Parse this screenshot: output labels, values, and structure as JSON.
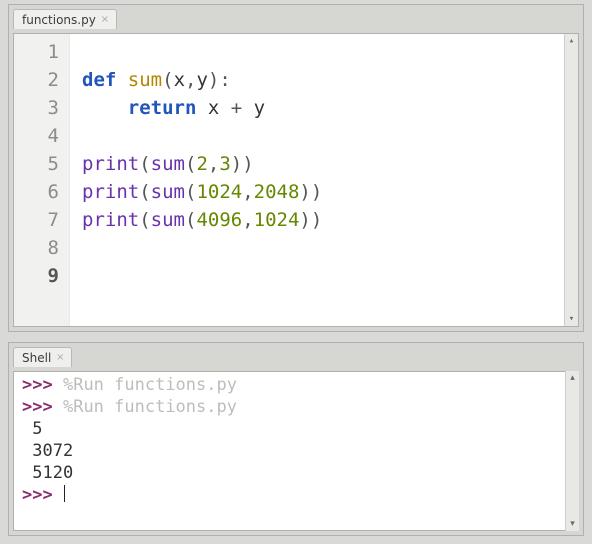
{
  "editor": {
    "tab_label": "functions.py",
    "gutter": [
      "1",
      "2",
      "3",
      "4",
      "5",
      "6",
      "7",
      "8",
      "9"
    ],
    "current_line_index": 8,
    "code": {
      "line1": "",
      "line2": {
        "kw_def": "def",
        "sp1": " ",
        "name": "sum",
        "args_open": "(",
        "arg1": "x",
        "comma1": ",",
        "arg2": "y",
        "args_close": ")",
        "colon": ":"
      },
      "line3": {
        "indent": "    ",
        "kw_return": "return",
        "sp1": " ",
        "x": "x",
        "sp2": " ",
        "plus": "+",
        "sp3": " ",
        "y": "y"
      },
      "line4": "",
      "line5": {
        "print": "print",
        "lp": "(",
        "sum": "sum",
        "lp2": "(",
        "n1": "2",
        "c": ",",
        "n2": "3",
        "rp2": ")",
        "rp": ")"
      },
      "line6": {
        "print": "print",
        "lp": "(",
        "sum": "sum",
        "lp2": "(",
        "n1": "1024",
        "c": ",",
        "n2": "2048",
        "rp2": ")",
        "rp": ")"
      },
      "line7": {
        "print": "print",
        "lp": "(",
        "sum": "sum",
        "lp2": "(",
        "n1": "4096",
        "c": ",",
        "n2": "1024",
        "rp2": ")",
        "rp": ")"
      },
      "line8": "",
      "line9": ""
    }
  },
  "shell": {
    "tab_label": "Shell",
    "prompt": ">>>",
    "run_cmd": "%Run functions.py",
    "outputs": [
      "5",
      "3072",
      "5120"
    ]
  }
}
